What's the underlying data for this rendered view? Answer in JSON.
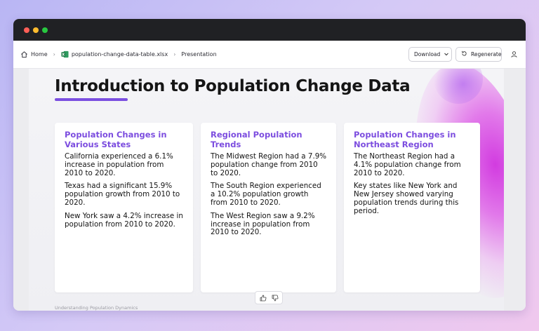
{
  "breadcrumb": {
    "home": "Home",
    "file": "population-change-data-table.xlsx",
    "current": "Presentation"
  },
  "toolbar": {
    "download_label": "Download",
    "regenerate_label": "Regenerate"
  },
  "slide": {
    "title": "Introduction to Population Change Data",
    "footer": "Understanding Population Dynamics",
    "cards": [
      {
        "title": "Population Changes in Various States",
        "paragraphs": [
          "California experienced a 6.1% increase in population from 2010 to 2020.",
          "Texas had a significant 15.9% population growth from 2010 to 2020.",
          "New York saw a 4.2% increase in population from 2010 to 2020."
        ]
      },
      {
        "title": "Regional Population Trends",
        "paragraphs": [
          "The Midwest Region had a 7.9% population change from 2010 to 2020.",
          "The South Region experienced a 10.2% population growth from 2010 to 2020.",
          "The West Region saw a 9.2% increase in population from 2010 to 2020."
        ]
      },
      {
        "title": "Population Changes in Northeast Region",
        "paragraphs": [
          "The Northeast Region had a 4.1% population change from 2010 to 2020.",
          "Key states like New York and New Jersey showed varying population trends during this period."
        ]
      }
    ]
  },
  "colors": {
    "accent": "#7b4fe0",
    "titlebar": "#202124",
    "excel_green": "#1d7a45"
  },
  "icons": {
    "home": "home-icon",
    "file": "excel-icon",
    "download": "chevron-down-icon",
    "regenerate": "refresh-icon",
    "user": "user-icon",
    "like": "thumbs-up-icon",
    "dislike": "thumbs-down-icon"
  }
}
